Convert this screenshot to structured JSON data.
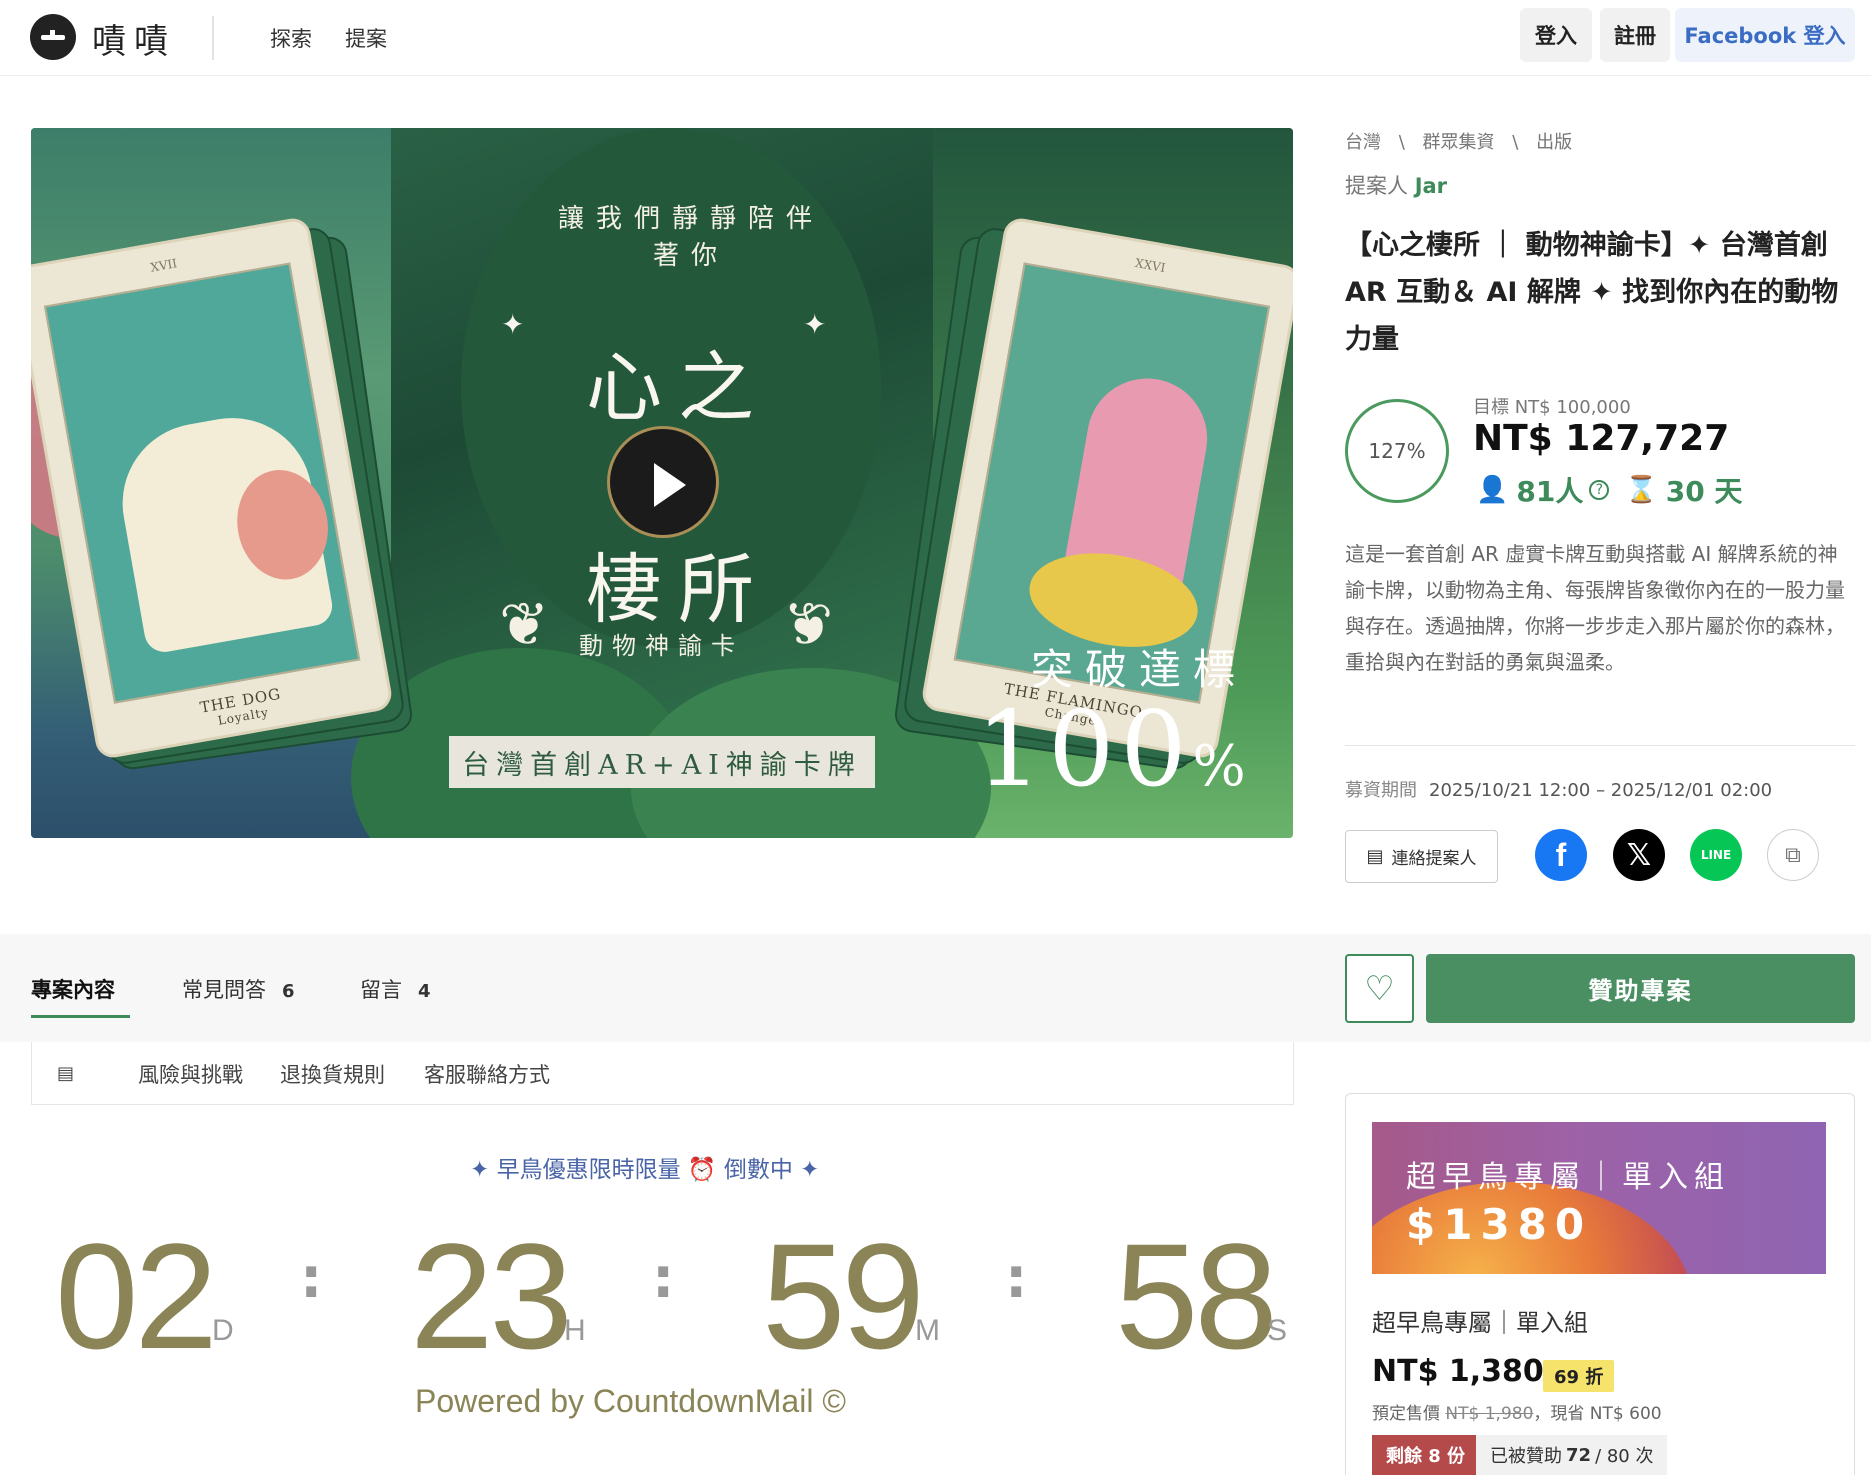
{
  "header": {
    "logo_text": "嘖嘖",
    "nav": [
      "探索",
      "提案"
    ],
    "login": "登入",
    "register": "註冊",
    "facebook_login": "Facebook 登入"
  },
  "hero": {
    "arc_text": "讓我們靜靜陪伴著你",
    "title_line1": "心之",
    "title_line2": "棲所",
    "subtitle": "動物神諭卡",
    "banner": "台灣首創AR+AI神諭卡牌",
    "left_card_numeral": "XVII",
    "left_card_name": "THE DOG",
    "left_card_keyword": "Loyalty",
    "right_card_numeral": "XXVI",
    "right_card_name": "THE FLAMINGO",
    "right_card_keyword": "Change",
    "milestone_label": "突破達標",
    "milestone_value": "100",
    "milestone_unit": "%"
  },
  "project": {
    "breadcrumb": [
      "台灣",
      "群眾集資",
      "出版"
    ],
    "breadcrumb_sep": "\\",
    "proposer_label": "提案人",
    "proposer_name": "Jar",
    "title": "【心之棲所 ｜ 動物神諭卡】✦ 台灣首創 AR 互動＆ AI 解牌 ✦ 找到你內在的動物力量",
    "percent": "127%",
    "goal": "目標 NT$ 100,000",
    "raised": "NT$ 127,727",
    "backers": "81人",
    "days_left": "30 天",
    "description": "這是一套首創 AR 虛實卡牌互動與搭載 AI 解牌系統的神諭卡牌，以動物為主角、每張牌皆象徵你內在的一股力量與存在。透過抽牌，你將一步步走入那片屬於你的森林，重拾與內在對話的勇氣與溫柔。",
    "period_label": "募資期間",
    "period": "2025/10/21 12:00 – 2025/12/01 02:00",
    "contact": "連絡提案人",
    "line_label": "LINE"
  },
  "tabs": [
    {
      "label": "專案內容",
      "count": ""
    },
    {
      "label": "常見問答",
      "count": "6"
    },
    {
      "label": "留言",
      "count": "4"
    }
  ],
  "support_button": "贊助專案",
  "subtabs": [
    "風險與挑戰",
    "退換貨規則",
    "客服聯絡方式"
  ],
  "countdown": {
    "title": "✦ 早鳥優惠限時限量 ⏰ 倒數中 ✦",
    "days": "02",
    "days_unit": "D",
    "hours": "23",
    "hours_unit": "H",
    "minutes": "59",
    "minutes_unit": "M",
    "seconds": "58",
    "seconds_unit": "S",
    "powered": "Powered by CountdownMail ©"
  },
  "reward": {
    "image_title": "超早鳥專屬｜單入組",
    "image_price": "$1380",
    "name": "超早鳥專屬｜單入組",
    "price": "NT$ 1,380",
    "discount": "69 折",
    "orig_prefix": "預定售價",
    "orig_price": "NT$ 1,980",
    "save_text": "，現省 NT$ 600",
    "remaining": "剩餘 8 份",
    "backed_prefix": "已被贊助",
    "backed_count": "72",
    "backed_total": "/ 80 次"
  },
  "colors": {
    "accent_green": "#3d8a5a",
    "facebook_blue": "#1877f2",
    "line_green": "#06c755",
    "countdown_gold": "#8a8456"
  }
}
